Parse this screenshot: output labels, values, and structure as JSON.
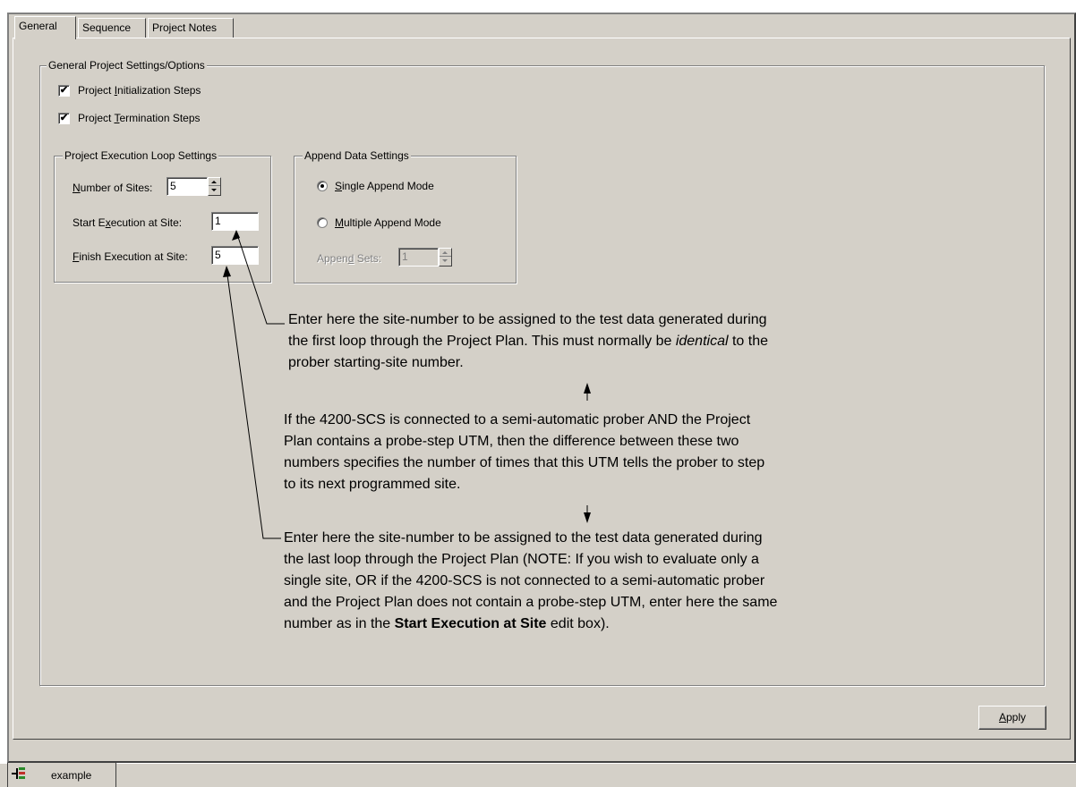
{
  "tabs": [
    {
      "label": "General",
      "active": true
    },
    {
      "label": "Sequence",
      "active": false
    },
    {
      "label": "Project Notes",
      "active": false
    }
  ],
  "general_group": {
    "legend": "General Project Settings/Options",
    "init_steps": {
      "pre": "Project ",
      "u": "I",
      "post": "nitialization Steps",
      "checked": true
    },
    "term_steps": {
      "pre": "Project ",
      "u": "T",
      "post": "ermination Steps",
      "checked": true
    }
  },
  "loop_group": {
    "legend": "Project Execution Loop Settings",
    "num_sites": {
      "u": "N",
      "post": "umber of Sites:",
      "value": "5"
    },
    "start_site": {
      "pre": "Start E",
      "u": "x",
      "post": "ecution at Site:",
      "value": "1"
    },
    "finish_site": {
      "u": "F",
      "post": "inish Execution at Site:",
      "value": "5"
    }
  },
  "append_group": {
    "legend": "Append Data Settings",
    "single": {
      "u": "S",
      "post": "ingle Append Mode",
      "checked": true
    },
    "multiple": {
      "u": "M",
      "post": "ultiple Append Mode",
      "checked": false
    },
    "sets": {
      "pre": "Appen",
      "u": "d",
      "post": " Sets:",
      "value": "1"
    }
  },
  "annotations": {
    "start_note": {
      "line1": "Enter here the site-number to be assigned to the test data generated during",
      "line2": "the first loop through the Project Plan. This must normally be ",
      "line2_em": "identical",
      "line2_end": " to the",
      "line3": "prober starting-site number."
    },
    "middle_note": {
      "line1": "If the 4200-SCS is connected to a semi-automatic prober AND the Project",
      "line2": "Plan contains a probe-step UTM, then the difference between these two",
      "line3": "numbers specifies the number of times that this UTM tells the prober to step",
      "line4": "to its next programmed site."
    },
    "finish_note": {
      "line1": "Enter here the site-number to be assigned to the test data generated during",
      "line2": "the last loop through the Project Plan (NOTE: If you wish to evaluate only a",
      "line3": "single site, OR if the 4200-SCS is not connected to a semi-automatic prober",
      "line4": "and the Project Plan does not contain a probe-step UTM, enter here the same",
      "line5_pre": "number as in the ",
      "line5_bold": "Start Execution at Site",
      "line5_post": " edit box)."
    }
  },
  "apply_button": {
    "u": "A",
    "post": "pply"
  },
  "taskbar": {
    "item": "example",
    "icon": "project-tree-icon"
  }
}
